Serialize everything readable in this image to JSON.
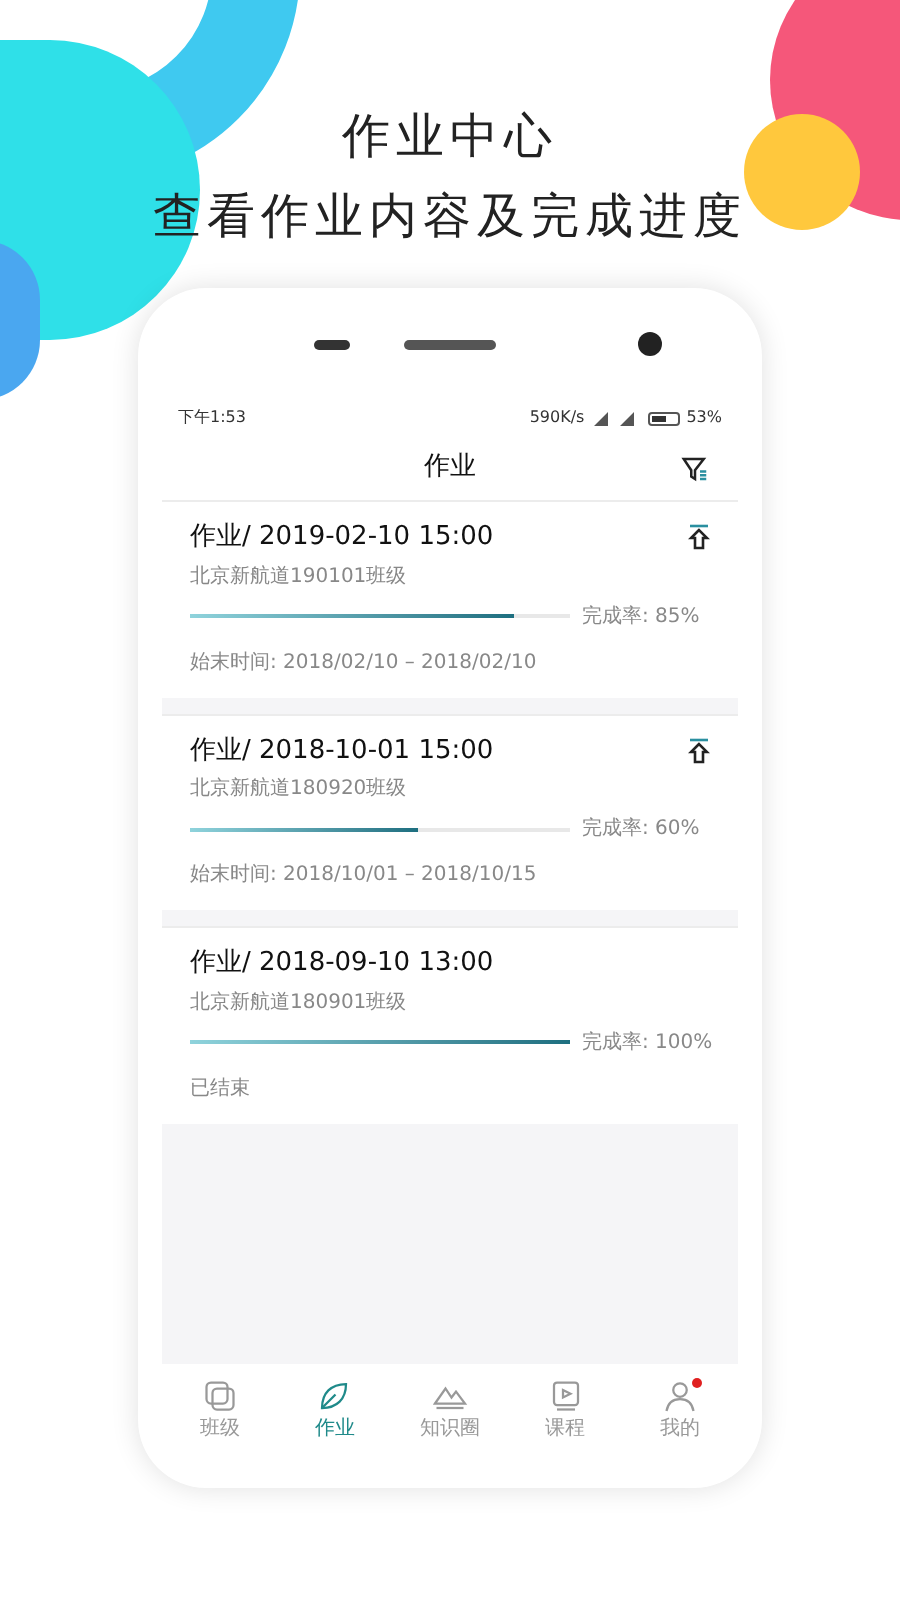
{
  "headline": [
    "作业中心",
    "查看作业内容及完成进度"
  ],
  "status_bar": {
    "time": "下午1:53",
    "speed": "590K/s",
    "battery": "53%"
  },
  "title": "作业",
  "assignments": [
    {
      "title": "作业/ 2019-02-10 15:00",
      "class": "北京新航道190101班级",
      "level": 0.85,
      "rate": "完成率: 85%",
      "footer": "始末时间: 2018/02/10 – 2018/02/10",
      "upload_icon": true
    },
    {
      "title": "作业/ 2018-10-01 15:00",
      "class": "北京新航道180920班级",
      "level": 0.6,
      "rate": "完成率: 60%",
      "footer": "始末时间: 2018/10/01 – 2018/10/15",
      "upload_icon": true
    },
    {
      "title": "作业/ 2018-09-10 13:00",
      "class": "北京新航道180901班级",
      "level": 1,
      "rate": "完成率: 100%",
      "footer": "已结束",
      "upload_icon": false
    }
  ],
  "tabs": [
    {
      "label": "班级",
      "kind": "class",
      "selected": false,
      "badge": false
    },
    {
      "label": "作业",
      "kind": "homework",
      "selected": true,
      "badge": false
    },
    {
      "label": "知识圈",
      "kind": "knowledge",
      "selected": false,
      "badge": false
    },
    {
      "label": "课程",
      "kind": "course",
      "selected": false,
      "badge": false
    },
    {
      "label": "我的",
      "kind": "me",
      "selected": false,
      "badge": true
    }
  ]
}
